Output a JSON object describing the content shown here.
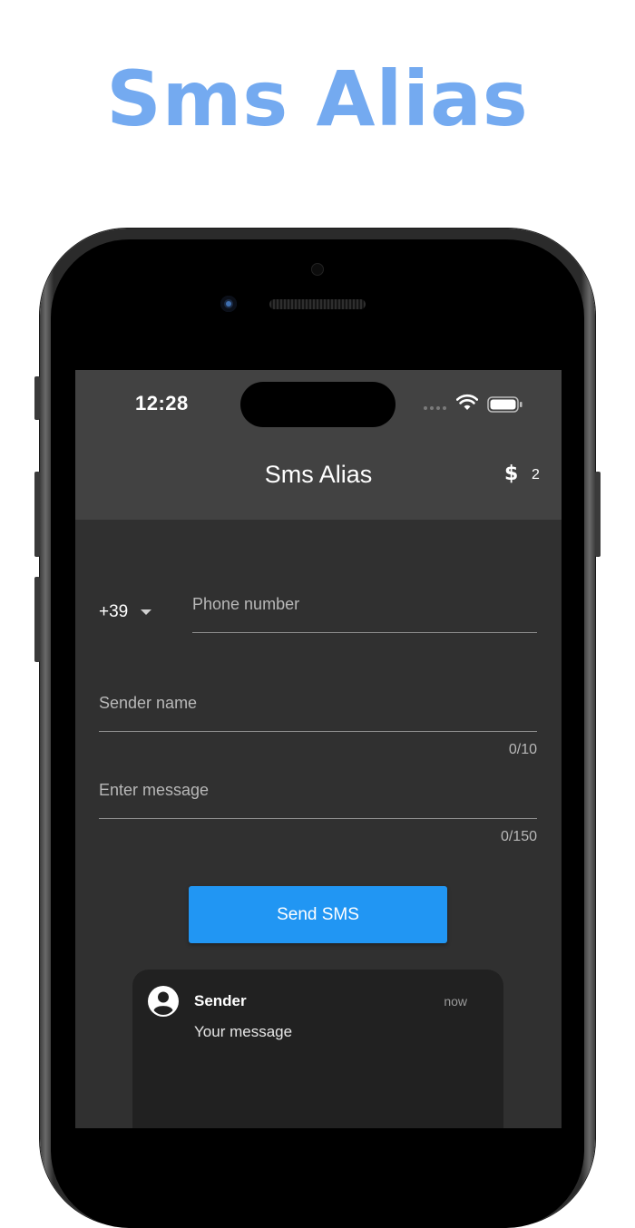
{
  "headline": "Sms Alias",
  "status_bar": {
    "time": "12:28"
  },
  "app_bar": {
    "title": "Sms Alias",
    "credits": "2",
    "credits_icon": "dollar-icon"
  },
  "form": {
    "country_code": "+39",
    "phone_placeholder": "Phone number",
    "sender_placeholder": "Sender name",
    "sender_counter": "0/10",
    "message_placeholder": "Enter message",
    "message_counter": "0/150",
    "send_label": "Send SMS"
  },
  "preview": {
    "sender": "Sender",
    "time": "now",
    "message": "Your message",
    "avatar_icon": "account-circle-icon"
  },
  "colors": {
    "headline": "#74aaf0",
    "button": "#2196f3",
    "app_bar": "#424242",
    "background": "#303030",
    "preview": "#212121"
  }
}
